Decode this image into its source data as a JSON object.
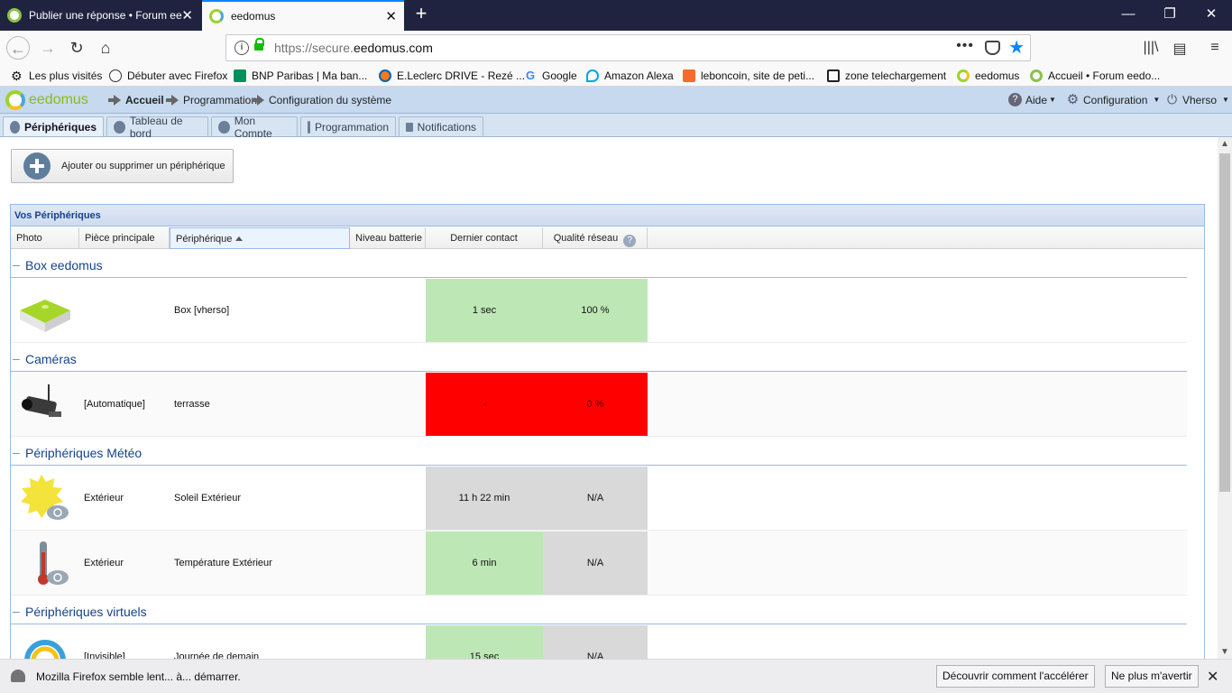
{
  "browser": {
    "tabs": [
      {
        "label": "Publier une réponse • Forum eedomus",
        "active": false
      },
      {
        "label": "eedomus",
        "active": true
      }
    ],
    "url_prefix": "https://secure.",
    "url_domain": "eedomus.com",
    "bookmarks": [
      {
        "label": "Les plus visités",
        "icon": "gear-icon"
      },
      {
        "label": "Débuter avec Firefox",
        "icon": "globe-icon"
      },
      {
        "label": "BNP Paribas | Ma ban...",
        "icon": "bnp-icon"
      },
      {
        "label": "E.Leclerc DRIVE - Rezé ...",
        "icon": "leclerc-icon"
      },
      {
        "label": "Google",
        "icon": "google-icon"
      },
      {
        "label": "Amazon Alexa",
        "icon": "alexa-icon"
      },
      {
        "label": "leboncoin, site de peti...",
        "icon": "leboncoin-icon"
      },
      {
        "label": "zone telechargement",
        "icon": "zt-icon"
      },
      {
        "label": "eedomus",
        "icon": "eedomus-icon"
      },
      {
        "label": "Accueil • Forum eedo...",
        "icon": "forum-icon"
      }
    ]
  },
  "app": {
    "logo": "eedomus",
    "breadcrumb": [
      "Accueil",
      "Programmation",
      "Configuration du système"
    ],
    "menu": {
      "help": "Aide",
      "config": "Configuration",
      "user": "Vherso"
    },
    "tabs": [
      "Périphériques",
      "Tableau de bord",
      "Mon Compte",
      "Programmation",
      "Notifications"
    ],
    "add_button": "Ajouter ou supprimer un périphérique",
    "panel_title": "Vos Périphériques",
    "columns": [
      "Photo",
      "Pièce principale",
      "Périphérique",
      "Niveau batterie",
      "Dernier contact",
      "Qualité réseau"
    ],
    "groups": [
      {
        "title": "Box eedomus",
        "rows": [
          {
            "room": "",
            "device": "Box [vherso]",
            "battery": "",
            "contact": "1 sec",
            "quality": "100 %",
            "contact_status": "green",
            "quality_status": "green",
            "photo": "box-icon"
          }
        ]
      },
      {
        "title": "Caméras",
        "rows": [
          {
            "room": "[Automatique]",
            "device": "terrasse",
            "battery": "",
            "contact": "-",
            "quality": "0 %",
            "contact_status": "red",
            "quality_status": "red",
            "photo": "camera-icon"
          }
        ]
      },
      {
        "title": "Périphériques Météo",
        "rows": [
          {
            "room": "Extérieur",
            "device": "Soleil Extérieur",
            "battery": "",
            "contact": "11 h 22 min",
            "quality": "N/A",
            "contact_status": "grey",
            "quality_status": "grey",
            "photo": "sun-icon"
          },
          {
            "room": "Extérieur",
            "device": "Température Extérieur",
            "battery": "",
            "contact": "6 min",
            "quality": "N/A",
            "contact_status": "green",
            "quality_status": "grey",
            "photo": "thermometer-icon"
          }
        ]
      },
      {
        "title": "Périphériques virtuels",
        "rows": [
          {
            "room": "[Invisible]",
            "device": "Journée de demain",
            "battery": "",
            "contact": "15 sec",
            "quality": "N/A",
            "contact_status": "green",
            "quality_status": "grey",
            "photo": "ring-icon"
          }
        ]
      }
    ]
  },
  "notification": {
    "text": "Mozilla Firefox semble lent... à... démarrer.",
    "learn": "Découvrir comment l'accélérer",
    "dismiss": "Ne plus m'avertir"
  },
  "colors": {
    "green": "#bde8b5",
    "red": "#ff0000",
    "grey": "#d9d9d9",
    "header_blue": "#15428b"
  }
}
